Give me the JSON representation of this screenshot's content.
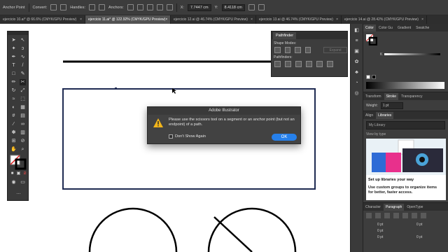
{
  "control_bar": {
    "anchor_point": "Anchor Point",
    "convert": "Convert:",
    "handles": "Handles:",
    "anchors": "Anchors:",
    "x_value": "7.7447 cm",
    "y_value": "8.4118 cm"
  },
  "tabs": [
    {
      "label": "ejercicio 10.ai* @ 66.6% (CMYK/GPU Preview)",
      "active": false
    },
    {
      "label": "ejercicio 11.ai* @ 122.92% (CMYK/GPU Preview)",
      "active": true
    },
    {
      "label": "ejercicio 12.ai @ 46.74% (CMYK/GPU Preview)",
      "active": false
    },
    {
      "label": "ejercicio 13.ai @ 46.74% (CMYK/GPU Preview)",
      "active": false
    },
    {
      "label": "ejercicio 14.ai @ 28.42% (CMYK/GPU Preview)",
      "active": false
    }
  ],
  "pathfinder": {
    "title": "Pathfinder",
    "shape_modes": "Shape Modes:",
    "pathfinders": "Pathfinders:",
    "expand": "Expand"
  },
  "color_panel": {
    "tabs": [
      "Color",
      "Color Gu",
      "Gradient",
      "Swatche"
    ],
    "k_label": "K"
  },
  "stroke_panel": {
    "tabs": [
      "Transform",
      "Stroke",
      "Transparency"
    ],
    "weight_label": "Weight:",
    "weight_value": "1 pt"
  },
  "libraries_panel": {
    "tabs": [
      "Align",
      "Libraries"
    ],
    "library": "My Library",
    "view_by": "View by type",
    "promo_title": "Set up libraries your way",
    "promo_text": "Use custom groups to organize items for better, faster access."
  },
  "bottom_panel": {
    "tabs": [
      "Character",
      "Paragraph",
      "OpenType"
    ],
    "values": [
      "0 pt",
      "0 pt",
      "0 pt",
      "0 pt",
      "0 pt"
    ]
  },
  "dialog": {
    "title": "Adobe Illustrator",
    "message": "Please use the scissors tool on a segment or an anchor point (but not an endpoint) of a path.",
    "checkbox_label": "Don't Show Again",
    "ok_label": "OK"
  },
  "colors": {
    "ui_dark": "#3c3c3c",
    "accent": "#2680eb",
    "artboard": "#ffffff",
    "selection": "#1f2a52",
    "warning": "#f2b51b"
  }
}
